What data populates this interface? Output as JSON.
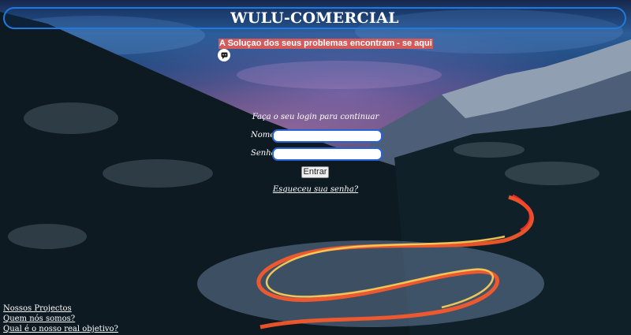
{
  "header": {
    "title": "WULU-COMERCIAL",
    "slogan": "A Soluçao dos seus problemas encontram - se aqui"
  },
  "login": {
    "prompt": "Faça o seu login para continuar",
    "name_label": "Nome",
    "name_value": "",
    "password_label": "Senha",
    "password_value": "",
    "submit_label": "Entrar",
    "forgot_label": "Esqueceu sua senha?"
  },
  "footer": {
    "links": [
      "Nossos Projectos",
      "Quem nós somos?",
      "Qual é o nosso real objetivo?"
    ]
  },
  "icons": {
    "chat": "chat-bubble-icon"
  },
  "colors": {
    "accent_border": "#1e7ae0",
    "slogan_bg": "#d25b5b",
    "input_border": "#2a62d6"
  }
}
